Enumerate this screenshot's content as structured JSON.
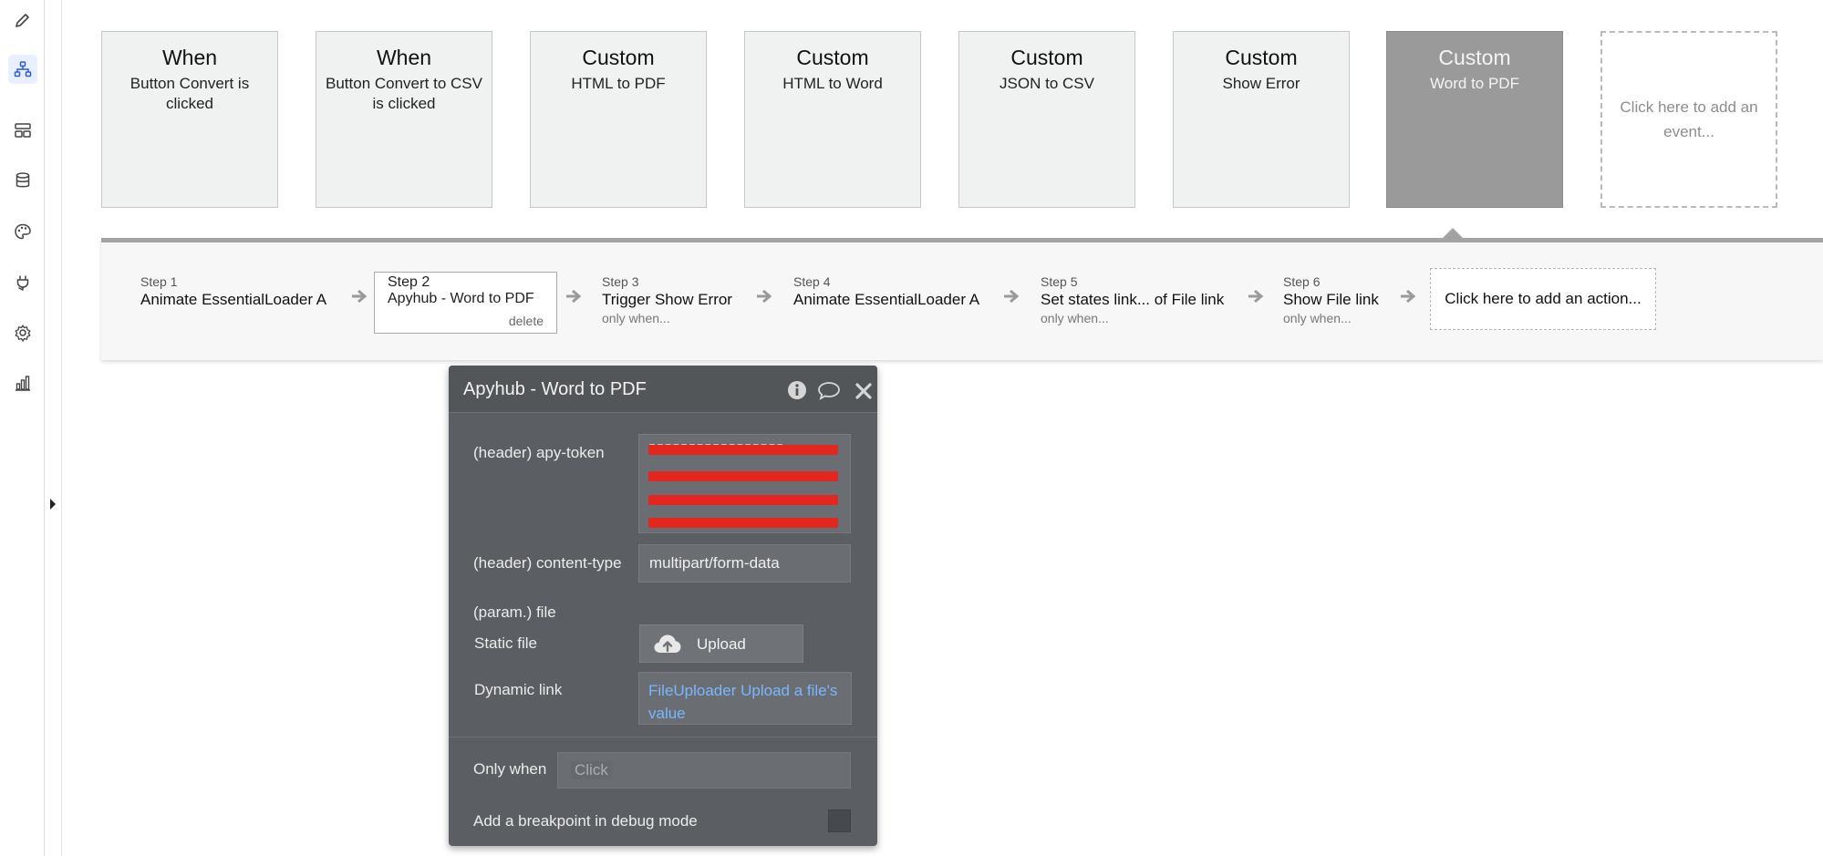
{
  "sidebar": {
    "icons": [
      "pencil-icon",
      "workflow-icon",
      "data-types-icon",
      "database-icon",
      "palette-icon",
      "plugin-icon",
      "settings-icon",
      "chart-icon"
    ],
    "active": "workflow-icon",
    "accent": "#2f5bd8"
  },
  "events": [
    {
      "kind": "When",
      "name": "Button Convert is clicked"
    },
    {
      "kind": "When",
      "name": "Button Convert to CSV is clicked"
    },
    {
      "kind": "Custom",
      "name": "HTML to PDF"
    },
    {
      "kind": "Custom",
      "name": "HTML to Word"
    },
    {
      "kind": "Custom",
      "name": "JSON to CSV"
    },
    {
      "kind": "Custom",
      "name": "Show Error"
    },
    {
      "kind": "Custom",
      "name": "Word to PDF",
      "selected": true
    }
  ],
  "add_event": "Click here to add an event...",
  "steps": [
    {
      "label": "Step 1",
      "name": "Animate EssentialLoader A",
      "sub": ""
    },
    {
      "label": "Step 2",
      "name": "Apyhub - Word to PDF",
      "sub": "delete"
    },
    {
      "label": "Step 3",
      "name": "Trigger Show Error",
      "sub": "only when..."
    },
    {
      "label": "Step 4",
      "name": "Animate EssentialLoader A",
      "sub": ""
    },
    {
      "label": "Step 5",
      "name": "Set states link... of File link",
      "sub": "only when..."
    },
    {
      "label": "Step 6",
      "name": "Show File link",
      "sub": "only when..."
    }
  ],
  "add_action": "Click here to add an action...",
  "panel": {
    "title": "Apyhub - Word to PDF",
    "fields": {
      "apy_token_label": "(header) apy-token",
      "content_type_label": "(header) content-type",
      "content_type_value": "multipart/form-data",
      "file_param_label": "(param.) file",
      "static_file_label": "Static file",
      "upload_label": "Upload",
      "dynamic_link_label": "Dynamic link",
      "dynamic_link_value": "FileUploader Upload a file's value",
      "only_when_label": "Only when",
      "only_when_placeholder": "Click",
      "breakpoint_label": "Add a breakpoint in debug mode"
    },
    "colors": {
      "panel_bg": "#5b5e63",
      "redaction": "#e5261f",
      "dynamic_link": "#79b7ff"
    }
  }
}
